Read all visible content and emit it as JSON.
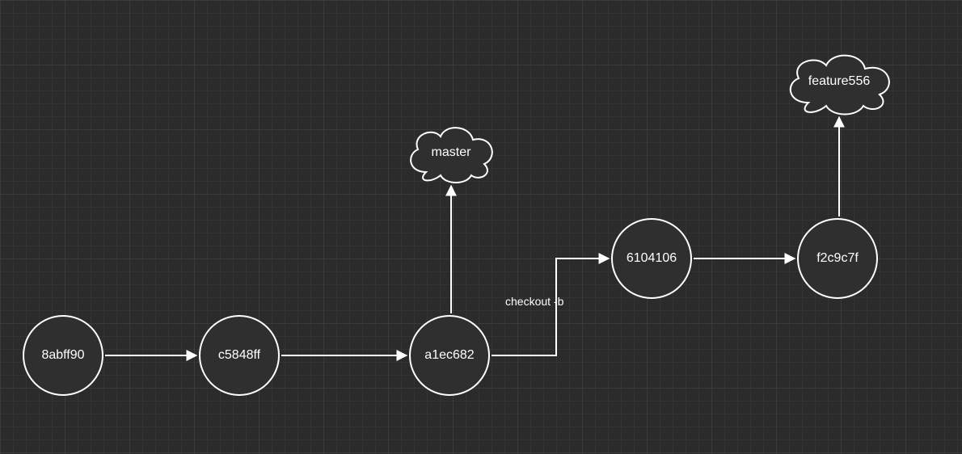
{
  "nodes": {
    "c1": {
      "label": "8abff90"
    },
    "c2": {
      "label": "c5848ff"
    },
    "c3": {
      "label": "a1ec682"
    },
    "c4": {
      "label": "6104106"
    },
    "c5": {
      "label": "f2c9c7f"
    }
  },
  "branches": {
    "b1": {
      "label": "master"
    },
    "b2": {
      "label": "feature556"
    }
  },
  "edges": {
    "checkout": {
      "label": "checkout -b"
    }
  },
  "colors": {
    "bg": "#2b2b2b",
    "grid_minor": "#333333",
    "grid_major": "#3a3a3a",
    "node_fill": "#2f2f2f",
    "stroke": "#ffffff",
    "text": "#ffffff"
  }
}
